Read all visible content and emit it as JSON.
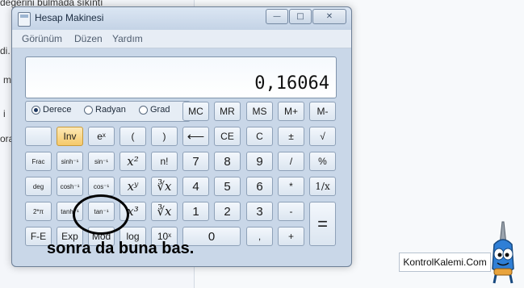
{
  "background": {
    "lines": [
      "değerini bulmada sıkıntı",
      "di.",
      "m",
      "i",
      "ora"
    ]
  },
  "window": {
    "title": "Hesap Makinesi",
    "controls": {
      "minimize": "—",
      "maximize": "□",
      "close": "✕"
    }
  },
  "menu": [
    "Görünüm",
    "Düzen",
    "Yardım"
  ],
  "display": {
    "value": "0,16064"
  },
  "angle_modes": [
    {
      "label": "Derece",
      "selected": true
    },
    {
      "label": "Radyan",
      "selected": false
    },
    {
      "label": "Grad",
      "selected": false
    }
  ],
  "buttons": {
    "mc": "MC",
    "mr": "MR",
    "ms": "MS",
    "mplus": "M+",
    "mminus": "M-",
    "blank": "",
    "inv": "Inv",
    "ln": "eˣ",
    "lparen": "(",
    "rparen": ")",
    "backspace": "⟵",
    "ce": "CE",
    "c": "C",
    "plusminus": "±",
    "sqrt": "√",
    "frac": "Frac",
    "sinh": "sinh⁻¹",
    "sin": "sin⁻¹",
    "sq": "x²",
    "fact": "n!",
    "n7": "7",
    "n8": "8",
    "n9": "9",
    "div": "/",
    "pct": "%",
    "deg": "deg",
    "cosh": "cosh⁻¹",
    "cos": "cos⁻¹",
    "pow": "xʸ",
    "yroot": "∛x",
    "n4": "4",
    "n5": "5",
    "n6": "6",
    "mul": "*",
    "recip": "1/x",
    "pi2": "2*π",
    "tanh": "tanh⁻¹",
    "tan": "tan⁻¹",
    "cube": "x³",
    "croot": "∛x",
    "n1": "1",
    "n2": "2",
    "n3": "3",
    "sub": "-",
    "eq": "=",
    "fe": "F-E",
    "exp": "Exp",
    "mod": "Mod",
    "log": "log",
    "tenx": "10ˣ",
    "n0": "0",
    "dot": ",",
    "add": "+"
  },
  "annotation": {
    "text": "sonra da buna bas."
  },
  "watermark": {
    "text": "KontrolKalemi.Com"
  }
}
